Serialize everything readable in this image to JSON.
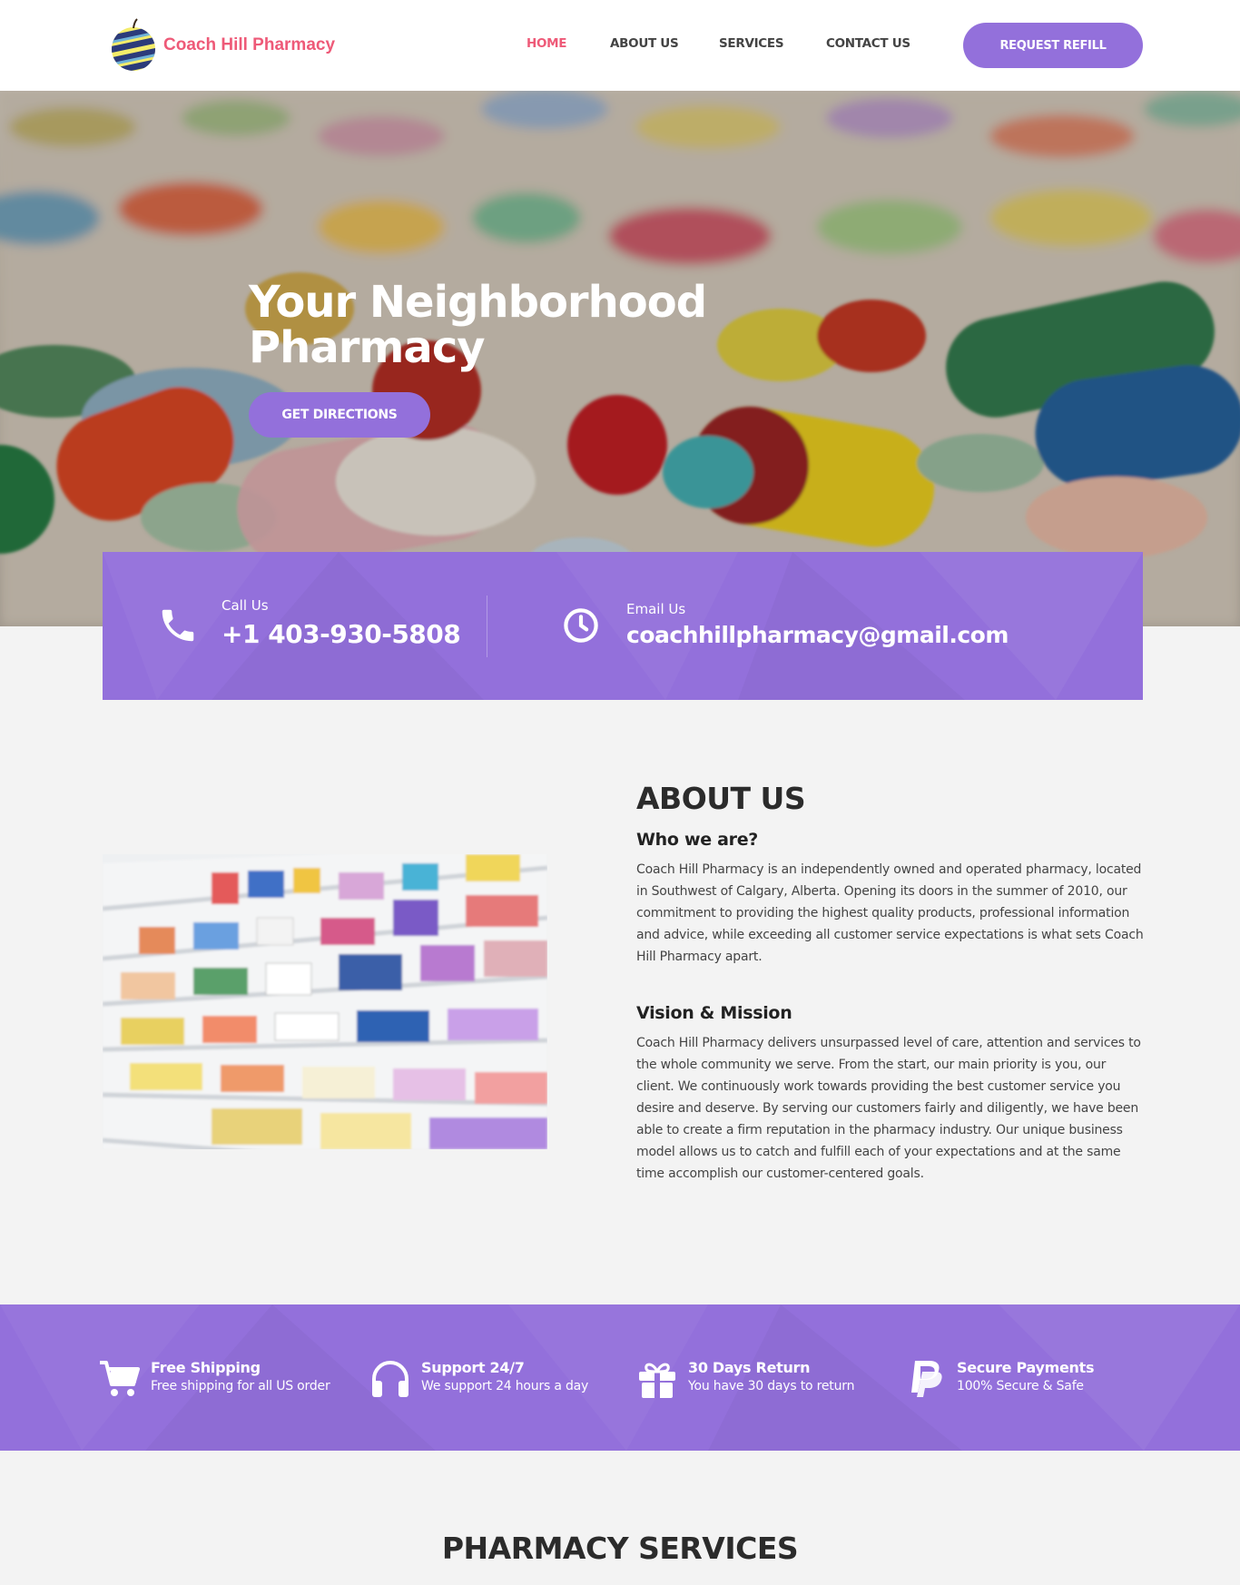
{
  "brand": {
    "name": "Coach Hill Pharmacy"
  },
  "nav": {
    "items": [
      {
        "label": "HOME",
        "active": true
      },
      {
        "label": "ABOUT US",
        "active": false
      },
      {
        "label": "SERVICES",
        "active": false
      },
      {
        "label": "CONTACT US",
        "active": false
      }
    ],
    "cta_label": "REQUEST REFILL"
  },
  "hero": {
    "title": "Your Neighborhood\nPharmacy",
    "button_label": "GET DIRECTIONS"
  },
  "contact": {
    "call_label": "Call Us",
    "call_value": "+1 403-930-5808",
    "email_label": "Email Us",
    "email_value": "coachhillpharmacy@gmail.com",
    "icons": [
      "phone-icon",
      "clock-icon"
    ]
  },
  "about": {
    "title": "ABOUT US",
    "who_heading": "Who we are?",
    "who_text": "Coach Hill Pharmacy is an independently owned and operated pharmacy, located in Southwest of Calgary, Alberta. Opening its doors in the summer of 2010, our commitment to providing the highest quality products, professional information and advice, while exceeding all customer service expectations is what sets Coach Hill Pharmacy apart.",
    "vision_heading": "Vision & Mission",
    "vision_text": "Coach Hill Pharmacy delivers unsurpassed level of care, attention and services to the whole community we serve.  From the start, our main priority is you, our client. We continuously work towards providing the best customer service you desire and deserve. By serving our customers fairly and diligently, we have been able to create a firm reputation in the pharmacy industry.  Our unique business model allows us to catch and fulfill each of your expectations and at the same time accomplish our customer-centered goals."
  },
  "features": [
    {
      "title": "Free Shipping",
      "subtitle": "Free shipping for all US order",
      "icon": "cart-icon"
    },
    {
      "title": "Support 24/7",
      "subtitle": "We support 24 hours a day",
      "icon": "headphones-icon"
    },
    {
      "title": "30 Days Return",
      "subtitle": "You have 30 days to return",
      "icon": "gift-icon"
    },
    {
      "title": "Secure Payments",
      "subtitle": "100% Secure & Safe",
      "icon": "paypal-icon"
    }
  ],
  "services": {
    "title": "PHARMACY SERVICES"
  },
  "colors": {
    "accent": "#9370db",
    "brand_pink": "#ee5a78",
    "text_dark": "#2b2b2b"
  }
}
